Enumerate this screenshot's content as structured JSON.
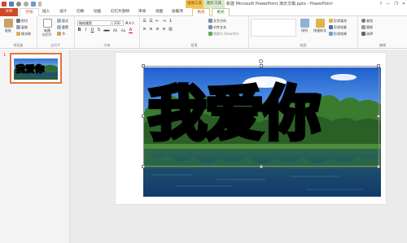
{
  "window": {
    "title": "新建 Microsoft PowerPoint 演示文稿.pptx - PowerPoint",
    "controls": [
      "?",
      "—",
      "❐",
      "✕"
    ]
  },
  "context_tabs": {
    "drawing_tools": "绘图工具",
    "picture_tools": "图片工具"
  },
  "tabs": [
    "文件",
    "开始",
    "插入",
    "设计",
    "切换",
    "动画",
    "幻灯片放映",
    "审阅",
    "视图",
    "加载项",
    "格式",
    "格式"
  ],
  "ribbon": {
    "clipboard": {
      "paste": "粘贴",
      "cut": "剪切",
      "copy": "复制",
      "format_painter": "格式刷",
      "group_label": "剪贴板"
    },
    "slides": {
      "new_slide": "新建\n幻灯片",
      "layout": "版式",
      "reset": "重置",
      "section": "节",
      "group_label": "幻灯片"
    },
    "font": {
      "font_name": "微软雅黑",
      "font_size": "250",
      "group_label": "字体",
      "row1": [
        "B",
        "I",
        "U",
        "S",
        "abc",
        "AV",
        "Aa"
      ],
      "row2": [
        "A"
      ]
    },
    "paragraph": {
      "text_direction": "文字方向",
      "align_text": "对齐文本",
      "convert_smartart": "转换为 SmartArt",
      "group_label": "段落"
    },
    "drawing": {
      "arrange": "排列",
      "quick_styles": "快速样式",
      "shape_fill": "形状填充",
      "shape_outline": "形状轮廓",
      "shape_effects": "形状效果",
      "group_label": "绘图"
    },
    "editing": {
      "find": "查找",
      "replace": "替换",
      "select": "选择",
      "group_label": "编辑"
    }
  },
  "thumbnails": [
    {
      "number": "1"
    }
  ],
  "slide": {
    "wordart_text": "我爱你"
  },
  "colors": {
    "accent": "#d24726",
    "context_drawing": "#f6c24e",
    "context_picture": "#d9e7cf"
  }
}
